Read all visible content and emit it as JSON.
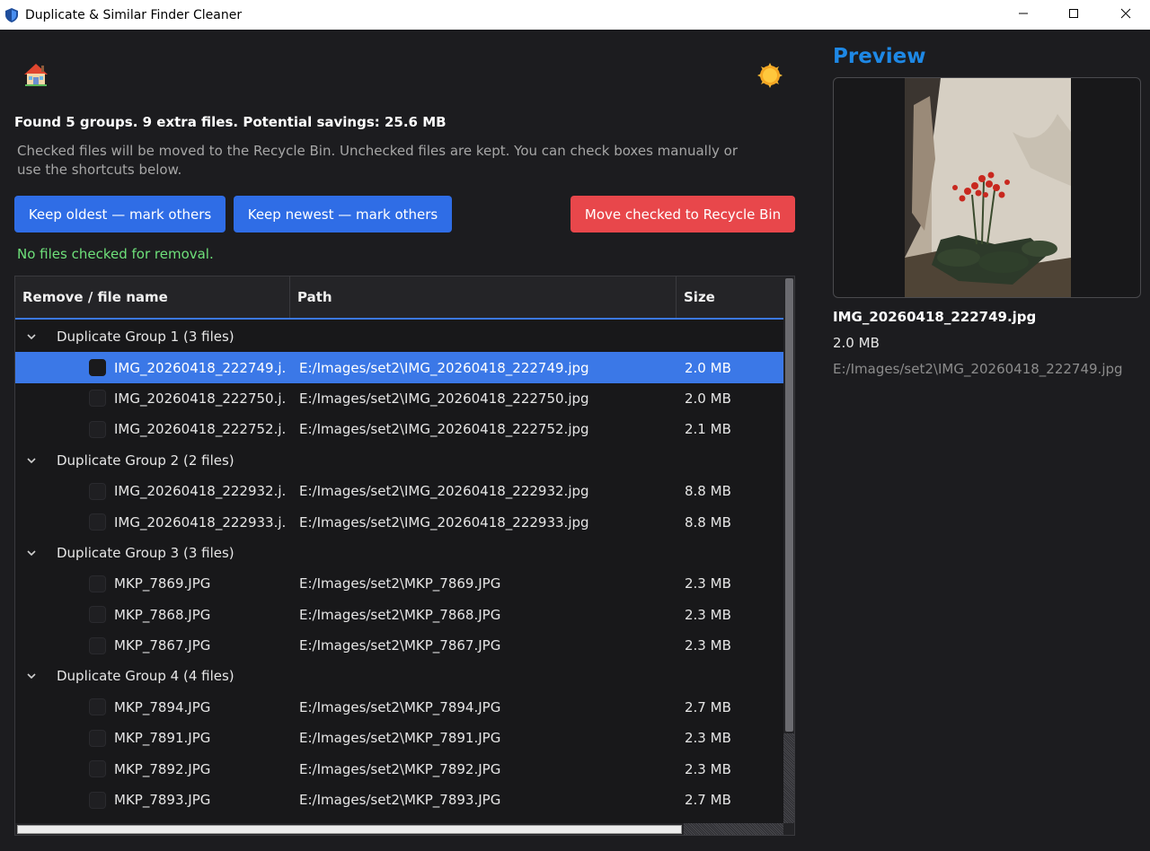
{
  "window": {
    "title": "Duplicate & Similar Finder Cleaner",
    "icons": {
      "app": "shield-icon",
      "minimize": "minimize-icon",
      "maximize": "maximize-icon",
      "close": "close-icon"
    }
  },
  "toolbar": {
    "home_icon": "home-icon",
    "theme_icon": "sun-icon"
  },
  "summary": "Found 5 groups. 9 extra files. Potential savings: 25.6 MB",
  "help_text": "Checked files will be moved to the Recycle Bin. Unchecked files are kept. You can check boxes manually or use the shortcuts below.",
  "actions": {
    "keep_oldest": "Keep oldest — mark others",
    "keep_newest": "Keep newest — mark others",
    "move_checked": "Move checked to Recycle Bin"
  },
  "colors": {
    "primary_button": "#2f6de6",
    "danger_button": "#e8474b",
    "status_ok": "#6ee07a",
    "selection": "#3b78e7",
    "preview_heading": "#1e88e5"
  },
  "status": "No files checked for removal.",
  "table": {
    "columns": [
      "Remove / file name",
      "Path",
      "Size"
    ],
    "groups": [
      {
        "label": "Duplicate Group 1 (3 files)",
        "files": [
          {
            "name": "IMG_20260418_222749.j...",
            "path": "E:/Images/set2\\IMG_20260418_222749.jpg",
            "size": "2.0 MB",
            "selected": true,
            "checked": false
          },
          {
            "name": "IMG_20260418_222750.j...",
            "path": "E:/Images/set2\\IMG_20260418_222750.jpg",
            "size": "2.0 MB",
            "selected": false,
            "checked": false
          },
          {
            "name": "IMG_20260418_222752.j...",
            "path": "E:/Images/set2\\IMG_20260418_222752.jpg",
            "size": "2.1 MB",
            "selected": false,
            "checked": false
          }
        ]
      },
      {
        "label": "Duplicate Group 2 (2 files)",
        "files": [
          {
            "name": "IMG_20260418_222932.j...",
            "path": "E:/Images/set2\\IMG_20260418_222932.jpg",
            "size": "8.8 MB",
            "selected": false,
            "checked": false
          },
          {
            "name": "IMG_20260418_222933.j...",
            "path": "E:/Images/set2\\IMG_20260418_222933.jpg",
            "size": "8.8 MB",
            "selected": false,
            "checked": false
          }
        ]
      },
      {
        "label": "Duplicate Group 3 (3 files)",
        "files": [
          {
            "name": "MKP_7869.JPG",
            "path": "E:/Images/set2\\MKP_7869.JPG",
            "size": "2.3 MB",
            "selected": false,
            "checked": false
          },
          {
            "name": "MKP_7868.JPG",
            "path": "E:/Images/set2\\MKP_7868.JPG",
            "size": "2.3 MB",
            "selected": false,
            "checked": false
          },
          {
            "name": "MKP_7867.JPG",
            "path": "E:/Images/set2\\MKP_7867.JPG",
            "size": "2.3 MB",
            "selected": false,
            "checked": false
          }
        ]
      },
      {
        "label": "Duplicate Group 4 (4 files)",
        "files": [
          {
            "name": "MKP_7894.JPG",
            "path": "E:/Images/set2\\MKP_7894.JPG",
            "size": "2.7 MB",
            "selected": false,
            "checked": false
          },
          {
            "name": "MKP_7891.JPG",
            "path": "E:/Images/set2\\MKP_7891.JPG",
            "size": "2.3 MB",
            "selected": false,
            "checked": false
          },
          {
            "name": "MKP_7892.JPG",
            "path": "E:/Images/set2\\MKP_7892.JPG",
            "size": "2.3 MB",
            "selected": false,
            "checked": false
          },
          {
            "name": "MKP_7893.JPG",
            "path": "E:/Images/set2\\MKP_7893.JPG",
            "size": "2.7 MB",
            "selected": false,
            "checked": false
          }
        ]
      }
    ]
  },
  "preview": {
    "heading": "Preview",
    "image_icon": "flower-photo",
    "file_name": "IMG_20260418_222749.jpg",
    "file_size": "2.0 MB",
    "file_path": "E:/Images/set2\\IMG_20260418_222749.jpg"
  }
}
